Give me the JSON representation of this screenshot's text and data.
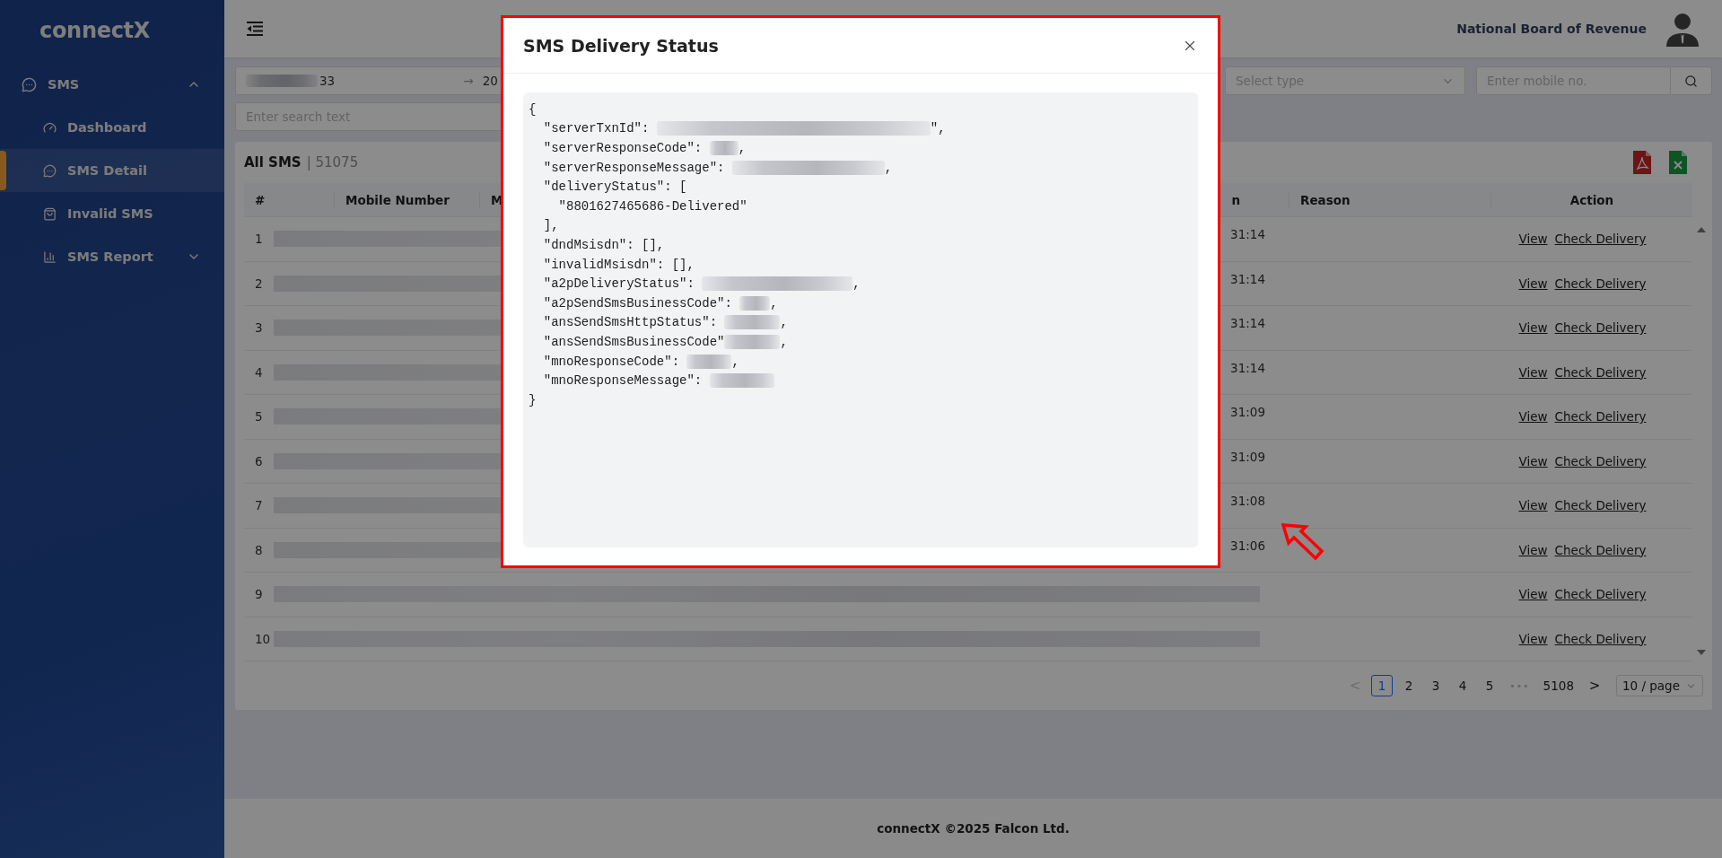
{
  "sidebar": {
    "logo": "connectX",
    "items": [
      {
        "label": "SMS",
        "expanded": true,
        "children": [
          {
            "label": "Dashboard",
            "selected": false
          },
          {
            "label": "SMS Detail",
            "selected": true
          },
          {
            "label": "Invalid SMS",
            "selected": false
          },
          {
            "label": "SMS Report",
            "selected": false,
            "expanded": false
          }
        ]
      }
    ]
  },
  "header": {
    "organization": "National Board of Revenue"
  },
  "filters": {
    "date_range": {
      "start_redacted": true,
      "start": "33",
      "separator": "→",
      "end": "20"
    },
    "search": {
      "placeholder": "Enter search text"
    },
    "type_select": {
      "placeholder": "Select type"
    },
    "mobile": {
      "placeholder": "Enter mobile no."
    }
  },
  "table_card": {
    "title": "All SMS",
    "count": "| 51075",
    "columns": [
      "#",
      "Mobile Number",
      "M",
      "n",
      "Reason",
      "Action"
    ],
    "rows": [
      {
        "number": "1",
        "time": "31:14",
        "actions": [
          "View",
          "Check Delivery"
        ]
      },
      {
        "number": "2",
        "time": "31:14",
        "actions": [
          "View",
          "Check Delivery"
        ]
      },
      {
        "number": "3",
        "time": "31:14",
        "actions": [
          "View",
          "Check Delivery"
        ]
      },
      {
        "number": "4",
        "time": "31:14",
        "actions": [
          "View",
          "Check Delivery"
        ]
      },
      {
        "number": "5",
        "time": "31:09",
        "actions": [
          "View",
          "Check Delivery"
        ]
      },
      {
        "number": "6",
        "time": "31:09",
        "actions": [
          "View",
          "Check Delivery"
        ]
      },
      {
        "number": "7",
        "time": "31:08",
        "actions": [
          "View",
          "Check Delivery"
        ]
      },
      {
        "number": "8",
        "time": "31:06",
        "actions": [
          "View",
          "Check Delivery"
        ]
      },
      {
        "number": "9",
        "actions": [
          "View",
          "Check Delivery"
        ]
      },
      {
        "number": "10",
        "actions": [
          "View",
          "Check Delivery"
        ]
      }
    ],
    "pagination": {
      "prev": {
        "text": "<",
        "disabled": true
      },
      "pages": [
        {
          "label": "1",
          "selected": true
        },
        {
          "label": "2",
          "selected": false
        },
        {
          "label": "3",
          "selected": false
        },
        {
          "label": "4",
          "selected": false
        },
        {
          "label": "5",
          "selected": false
        }
      ],
      "ellipsis": "•••",
      "last": "5108",
      "next": {
        "text": ">",
        "disabled": false
      },
      "page_size": "10 / page"
    }
  },
  "footer": "connectX ©2025 Falcon Ltd.",
  "modal": {
    "title": "SMS Delivery Status",
    "lines": [
      {
        "text": "{"
      },
      {
        "text": "  \"serverTxnId\": ",
        "redacted": true,
        "after": "\","
      },
      {
        "text": "  \"serverResponseCode\": ",
        "redacted": true,
        "after": ","
      },
      {
        "text": "  \"serverResponseMessage\": ",
        "redacted": true,
        "after": ","
      },
      {
        "text": "  \"deliveryStatus\": ["
      },
      {
        "text": "    \"8801627465686-Delivered\""
      },
      {
        "text": "  ],"
      },
      {
        "text": "  \"dndMsisdn\": [],"
      },
      {
        "text": "  \"invalidMsisdn\": [],"
      },
      {
        "text": "  \"a2pDeliveryStatus\": ",
        "redacted": true,
        "after": ","
      },
      {
        "text": "  \"a2pSendSmsBusinessCode\": ",
        "redacted": true,
        "after": ","
      },
      {
        "text": "  \"ansSendSmsHttpStatus\": ",
        "redacted": true,
        "after": ","
      },
      {
        "text": "  \"ansSendSmsBusinessCode\"",
        "redacted": true,
        "after": ","
      },
      {
        "text": "  \"mnoResponseCode\": ",
        "redacted": true,
        "after": ","
      },
      {
        "text": "  \"mnoResponseMessage\": ",
        "redacted": true
      },
      {
        "text": "}"
      }
    ]
  }
}
